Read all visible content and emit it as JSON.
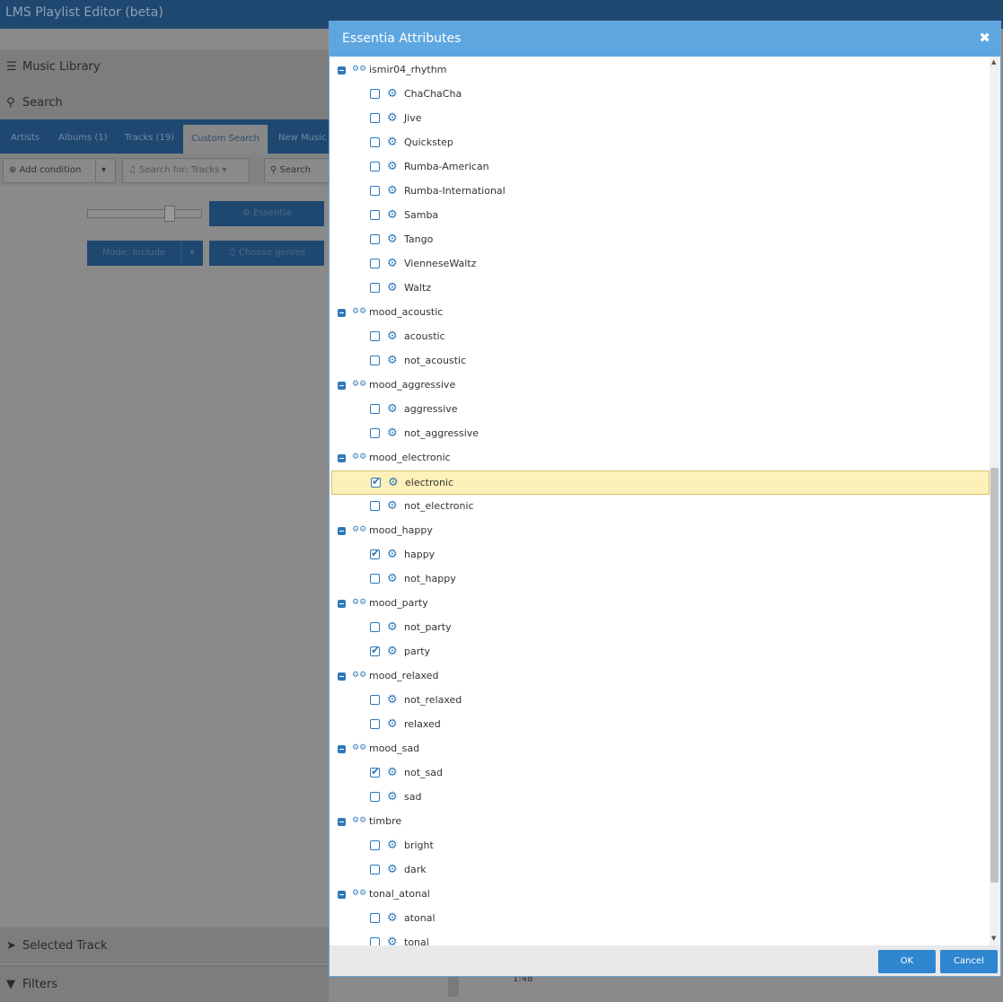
{
  "app": {
    "title": "LMS Playlist Editor (beta)",
    "music_library": "Music Library",
    "search": "Search",
    "tabs": [
      "Artists",
      "Albums (1)",
      "Tracks (19)",
      "Custom Search",
      "New Music"
    ],
    "toolbar": {
      "add_condition": "Add condition",
      "search_for": "Search for: Tracks",
      "search": "Search"
    },
    "essentia_button": "Essentia",
    "mode_button": "Mode: Include",
    "genres_button": "Choose genres",
    "selected_track": "Selected Track",
    "filters": "Filters",
    "time": "1:48"
  },
  "dialog": {
    "title": "Essentia Attributes",
    "ok": "OK",
    "cancel": "Cancel",
    "groups": [
      {
        "name": "ismir04_rhythm",
        "items": [
          {
            "label": "ChaChaCha",
            "checked": false
          },
          {
            "label": "Jive",
            "checked": false
          },
          {
            "label": "Quickstep",
            "checked": false
          },
          {
            "label": "Rumba-American",
            "checked": false
          },
          {
            "label": "Rumba-International",
            "checked": false
          },
          {
            "label": "Samba",
            "checked": false
          },
          {
            "label": "Tango",
            "checked": false
          },
          {
            "label": "VienneseWaltz",
            "checked": false
          },
          {
            "label": "Waltz",
            "checked": false
          }
        ]
      },
      {
        "name": "mood_acoustic",
        "items": [
          {
            "label": "acoustic",
            "checked": false
          },
          {
            "label": "not_acoustic",
            "checked": false
          }
        ]
      },
      {
        "name": "mood_aggressive",
        "items": [
          {
            "label": "aggressive",
            "checked": false
          },
          {
            "label": "not_aggressive",
            "checked": false
          }
        ]
      },
      {
        "name": "mood_electronic",
        "items": [
          {
            "label": "electronic",
            "checked": true,
            "highlighted": true
          },
          {
            "label": "not_electronic",
            "checked": false
          }
        ]
      },
      {
        "name": "mood_happy",
        "items": [
          {
            "label": "happy",
            "checked": true
          },
          {
            "label": "not_happy",
            "checked": false
          }
        ]
      },
      {
        "name": "mood_party",
        "items": [
          {
            "label": "not_party",
            "checked": false
          },
          {
            "label": "party",
            "checked": true
          }
        ]
      },
      {
        "name": "mood_relaxed",
        "items": [
          {
            "label": "not_relaxed",
            "checked": false
          },
          {
            "label": "relaxed",
            "checked": false
          }
        ]
      },
      {
        "name": "mood_sad",
        "items": [
          {
            "label": "not_sad",
            "checked": true
          },
          {
            "label": "sad",
            "checked": false
          }
        ]
      },
      {
        "name": "timbre",
        "items": [
          {
            "label": "bright",
            "checked": false
          },
          {
            "label": "dark",
            "checked": false
          }
        ]
      },
      {
        "name": "tonal_atonal",
        "items": [
          {
            "label": "atonal",
            "checked": false
          },
          {
            "label": "tonal",
            "checked": false
          }
        ]
      }
    ]
  }
}
